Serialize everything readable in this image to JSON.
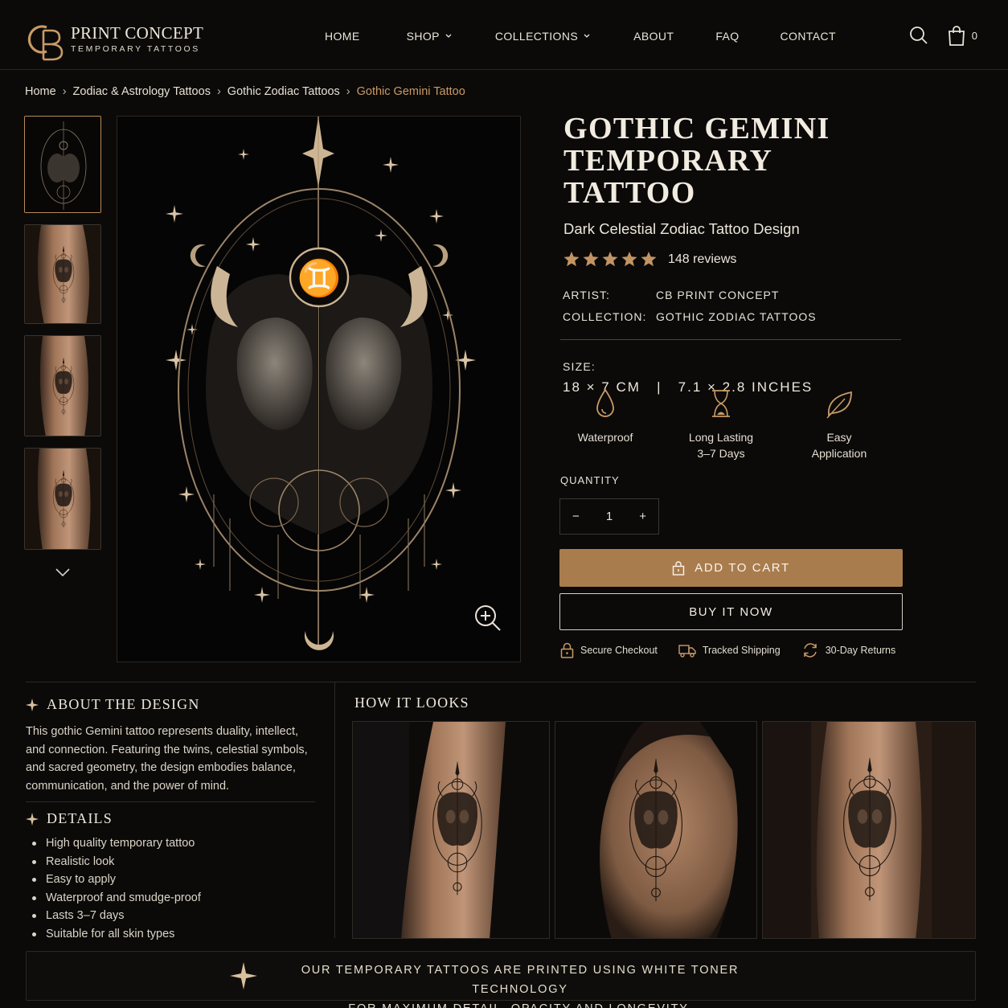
{
  "brand": {
    "monogram": "CB",
    "name": "PRINT CONCEPT",
    "tagline": "TEMPORARY TATTOOS"
  },
  "nav": [
    {
      "label": "HOME",
      "dropdown": false
    },
    {
      "label": "SHOP",
      "dropdown": true
    },
    {
      "label": "COLLECTIONS",
      "dropdown": true
    },
    {
      "label": "ABOUT",
      "dropdown": false
    },
    {
      "label": "FAQ",
      "dropdown": false
    },
    {
      "label": "CONTACT",
      "dropdown": false
    }
  ],
  "header_icons": {
    "search": "search-icon",
    "cart": "shopping-bag-icon",
    "cart_count": "0"
  },
  "breadcrumb": [
    "Home",
    "Zodiac & Astrology Tattoos",
    "Gothic Zodiac Tattoos",
    "Gothic Gemini Tattoo"
  ],
  "product": {
    "title_line1": "GOTHIC GEMINI",
    "title_line2": "TEMPORARY TATTOO",
    "subtitle": "Dark Celestial Zodiac Tattoo Design",
    "rating": 5,
    "reviews": "148 reviews",
    "artist_label": "ARTIST:",
    "artist": "CB PRINT CONCEPT",
    "collection_label": "COLLECTION:",
    "collection": "GOTHIC ZODIAC TATTOOS",
    "size_label": "SIZE:",
    "size": "18 × 7 CM   |   7.1 × 2.8 INCHES",
    "zodiac_glyph": "♊"
  },
  "features": [
    {
      "icon": "water-drop-icon",
      "line1": "Waterproof",
      "line2": ""
    },
    {
      "icon": "hourglass-icon",
      "line1": "Long Lasting",
      "line2": "3–7 Days"
    },
    {
      "icon": "leaf-icon",
      "line1": "Easy",
      "line2": "Application"
    }
  ],
  "quantity": {
    "label": "QUANTITY",
    "value": "1",
    "minus": "−",
    "plus": "+"
  },
  "buttons": {
    "add_to_cart": "ADD TO CART",
    "buy_now": "BUY IT NOW"
  },
  "trust": [
    {
      "icon": "lock-icon",
      "label": "Secure Checkout"
    },
    {
      "icon": "truck-icon",
      "label": "Tracked Shipping"
    },
    {
      "icon": "refresh-icon",
      "label": "30-Day Returns"
    }
  ],
  "about": {
    "title": "ABOUT THE DESIGN",
    "text": "This gothic Gemini tattoo represents duality, intellect, and connection. Featuring the twins, celestial symbols, and sacred geometry, the design embodies balance, communication, and the power of mind."
  },
  "details": {
    "title": "DETAILS",
    "items": [
      "High quality temporary tattoo",
      "Realistic look",
      "Easy to apply",
      "Waterproof and smudge-proof",
      "Lasts 3–7 days",
      "Suitable for all skin types"
    ]
  },
  "how": {
    "title": "HOW IT LOOKS"
  },
  "footer_note": {
    "line1": "OUR TEMPORARY TATTOOS ARE PRINTED USING WHITE TONER TECHNOLOGY",
    "line2": "FOR MAXIMUM DETAIL, OPACITY AND LONGEVITY."
  },
  "colors": {
    "background": "#0b0a09",
    "accent": "#c99a66",
    "button": "#a97c4e",
    "text": "#e9e2d6"
  }
}
